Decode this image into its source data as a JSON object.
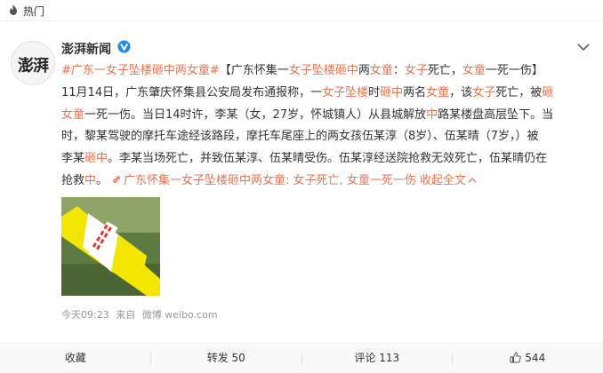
{
  "tag": {
    "label": "热门",
    "icon": "flame-icon"
  },
  "post": {
    "author": "澎湃新闻",
    "avatar_logo": "澎湃",
    "verified_icon": "verified-badge-icon",
    "menu_icon": "chevron-down-icon",
    "content": {
      "l1": {
        "topic": "#广东一女子坠楼砸中两女童#",
        "t1": "【广东怀集一",
        "h1": "女子坠楼砸中",
        "t2": "两",
        "h2": "女童",
        "t3": "：",
        "h3": "女子",
        "t4": "死亡，",
        "h4": "女童",
        "t5": "一死一伤】"
      },
      "l2": {
        "t1": "11月14日，广东肇庆怀集县公安局发布通报称，一",
        "h1": "女子坠楼",
        "t2": "时",
        "h2": "砸中",
        "t3": "两名",
        "h3": "女童",
        "t4": "，该",
        "h4": "女子",
        "t5": "死亡，被",
        "h5": "砸"
      },
      "l3": {
        "h1": "女童",
        "t1": "一死一伤。当日14时许，李某（女，27岁，怀城镇人）从县城解放",
        "h2": "中",
        "t2": "路某楼盘高层坠下。当"
      },
      "l4": {
        "t1": "时，黎某驾驶的摩托车途经该路段，摩托车尾座上的两女孩伍某淳（8岁）、伍某晴（7岁，）被"
      },
      "l5": {
        "t1": "李某",
        "h1": "砸中",
        "t2": "。李某当场死亡，并致伍某淳、伍某晴受伤。伍某淳经送院抢救无效死亡，伍某晴仍在"
      },
      "l6": {
        "t1": "抢救",
        "h1": "中",
        "t2": "。",
        "link": "广东怀集一女子坠楼砸中两女童: 女子死亡, 女童一死一伤",
        "collapse": "收起全文"
      }
    },
    "image": {
      "alt_text": "警戒线"
    },
    "meta": {
      "time": "今天09:23",
      "source_prefix": "来自",
      "source": "微博 weibo.com"
    }
  },
  "actions": {
    "collect": "收藏",
    "repost": "转发 50",
    "comment": "评论 113",
    "like_icon": "thumbs-up-icon",
    "like": "544"
  },
  "colors": {
    "highlight": "#eb7350",
    "link": "#eb7350",
    "text": "#333333",
    "meta": "#999999",
    "verified": "#1f8ae6"
  }
}
